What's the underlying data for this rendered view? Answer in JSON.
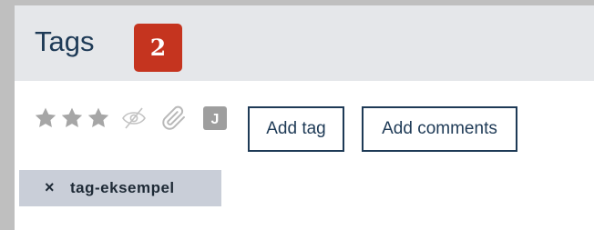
{
  "panel": {
    "title": "Tags",
    "step_badge": "2"
  },
  "toolbar": {
    "rating": {
      "value": 3,
      "max": 3
    },
    "icons": [
      "star-icon",
      "eye-slash-icon",
      "paperclip-icon",
      "j-badge-icon"
    ],
    "j_badge_label": "J",
    "add_tag_label": "Add tag",
    "add_comments_label": "Add comments"
  },
  "tags": [
    {
      "remove_symbol": "×",
      "label": "tag-eksempel"
    }
  ],
  "colors": {
    "accent_navy": "#1e3a56",
    "badge_red": "#c5341f",
    "header_gray": "#e5e7ea",
    "icon_gray": "#a6a6a6",
    "tag_chip": "#c9ced8"
  }
}
